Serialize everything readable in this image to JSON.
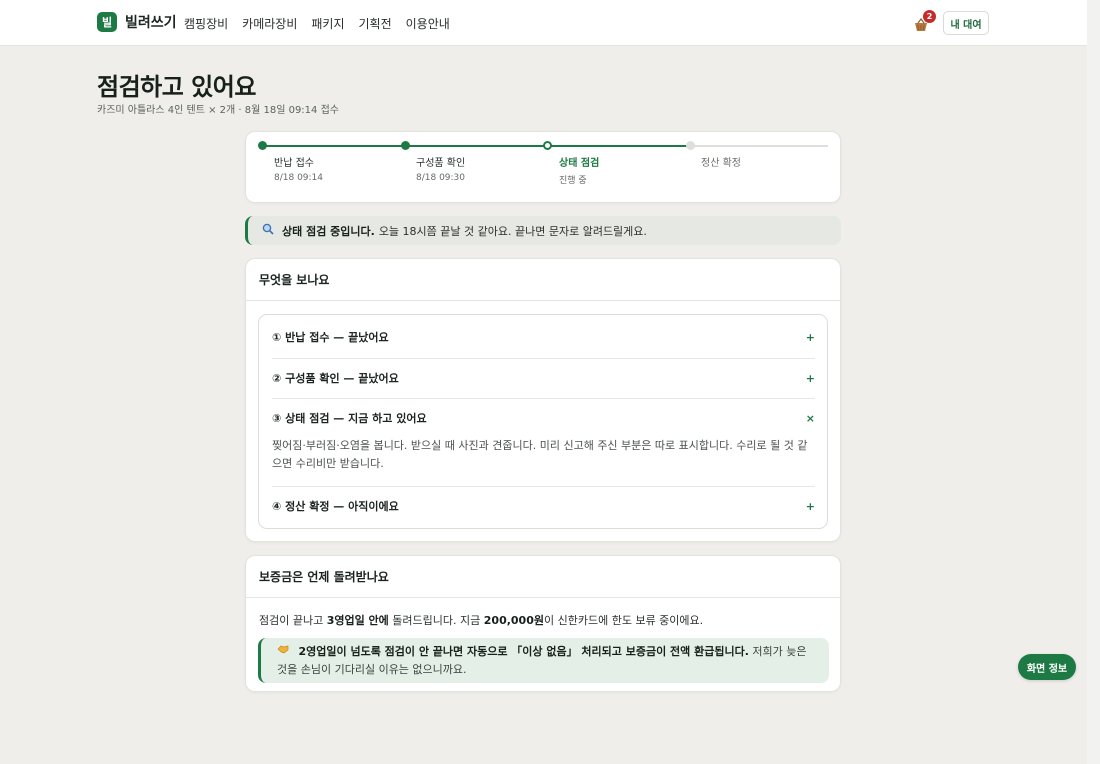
{
  "header": {
    "logo_glyph": "빌",
    "brand": "빌려쓰기",
    "nav": [
      "캠핑장비",
      "카메라장비",
      "패키지",
      "기획전",
      "이용안내"
    ],
    "cart_count": "2",
    "my_rental": "내 대여"
  },
  "page": {
    "title": "점검하고 있어요",
    "subtitle": "카즈미 아틀라스 4인 텐트 × 2개 · 8월 18일 09:14 접수"
  },
  "stepper": {
    "steps": [
      {
        "label": "반납 접수",
        "time": "8/18 09:14",
        "state": "done"
      },
      {
        "label": "구성품 확인",
        "time": "8/18 09:30",
        "state": "done"
      },
      {
        "label": "상태 점검",
        "time": "진행 중",
        "state": "current"
      },
      {
        "label": "정산 확정",
        "time": "",
        "state": "pending"
      }
    ],
    "done_color": "#1e7a45",
    "pending_color": "#dddfdb"
  },
  "notice": {
    "icon": "magnifier-icon",
    "bold": "상태 점검 중입니다.",
    "text": "오늘 18시쯤 끝날 것 같아요. 끝나면 문자로 알려드릴게요."
  },
  "check": {
    "title": "무엇을 보나요",
    "items": [
      {
        "label": "① 반납 접수 — 끝났어요",
        "sign": "+"
      },
      {
        "label": "② 구성품 확인 — 끝났어요",
        "sign": "+"
      },
      {
        "label": "③ 상태 점검 — 지금 하고 있어요",
        "sign": "×"
      },
      {
        "label": "④ 정산 확정 — 아직이에요",
        "sign": "+"
      }
    ],
    "expanded_body": "찢어짐·부러짐·오염을 봅니다. 받으실 때 사진과 견줍니다. 미리 신고해 주신 부분은 따로 표시합니다. 수리로 될 것 같으면 수리비만 받습니다."
  },
  "deposit": {
    "title": "보증금은 언제 돌려받나요",
    "t1": "점검이 끝나고 ",
    "b1": "3영업일 안에",
    "t2": " 돌려드립니다. 지금 ",
    "b2": "200,000원",
    "t3": "이 신한카드에 한도 보류 중이에요.",
    "note_icon": "handshake-icon",
    "note_bold": "2영업일이 넘도록 점검이 안 끝나면 자동으로 「이상 없음」 처리되고 보증금이 전액 환급됩니다.",
    "note_text": " 저희가 늦은 것을 손님이 기다리실 이유는 없으니까요."
  },
  "float_button": "화면 정보"
}
